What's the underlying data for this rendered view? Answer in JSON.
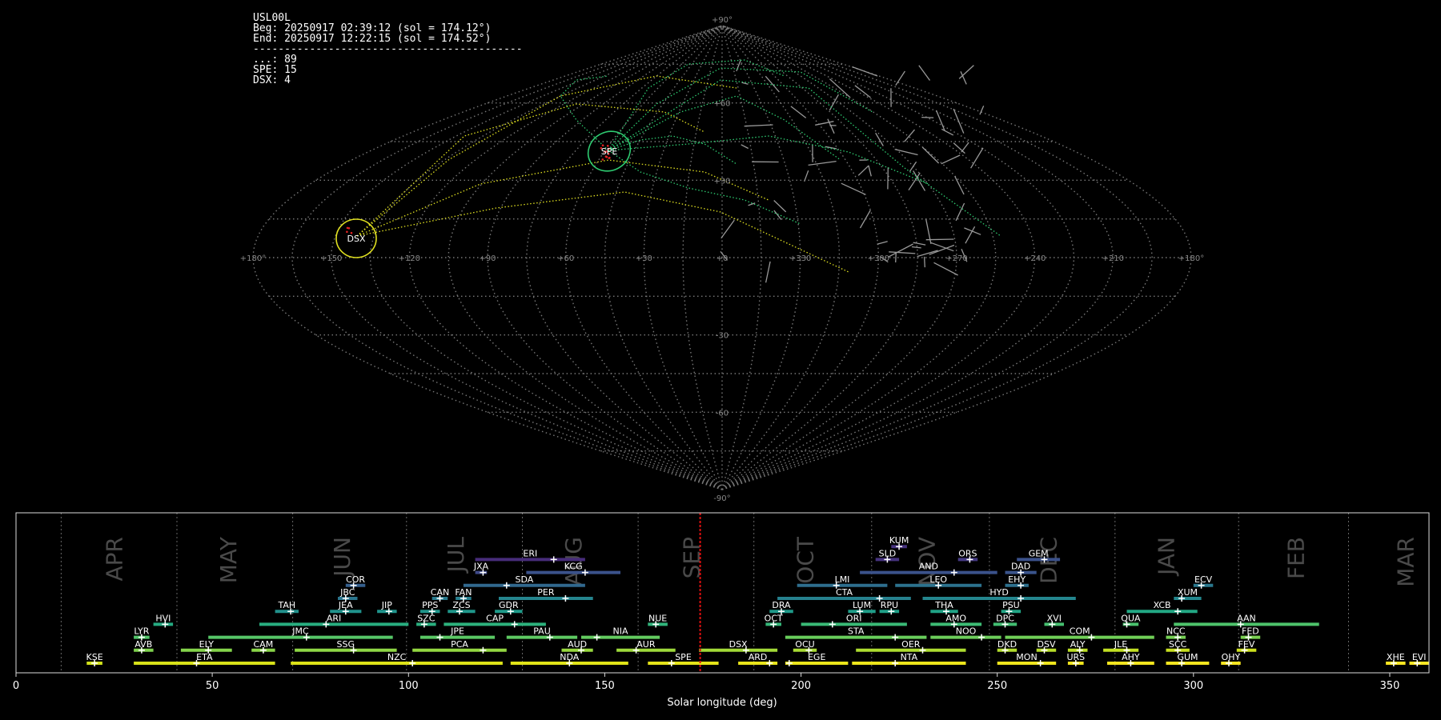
{
  "station": "USL00L",
  "begin_text": "Beg: 20250917 02:39:12 (sol = 174.12°)",
  "end_text": "End: 20250917 12:22:15 (sol = 174.52°)",
  "separator_text": "-------------------------------------------",
  "counts": [
    {
      "code": "...",
      "count": 89,
      "text": "...: 89"
    },
    {
      "code": "SPE",
      "count": 15,
      "text": "SPE: 15"
    },
    {
      "code": "DSX",
      "count": 4,
      "text": "DSX: 4"
    }
  ],
  "sky_map": {
    "projection": "sinusoidal",
    "lon_labels": [
      "+180°",
      "+150",
      "+120",
      "+90",
      "+60",
      "+30",
      "+0",
      "+330",
      "+300",
      "+270",
      "+240",
      "+210",
      "+180°"
    ],
    "lat_labels": [
      "+90°",
      "+60",
      "+30",
      "-30",
      "-60",
      "-90°"
    ],
    "radiants": [
      {
        "code": "SPE",
        "color": "#2ecc71"
      },
      {
        "code": "DSX",
        "color": "#e0e020"
      }
    ]
  },
  "chart_data": {
    "type": "timeline",
    "xlabel": "Solar longitude (deg)",
    "xlim": [
      0,
      360
    ],
    "x_ticks": [
      0,
      50,
      100,
      150,
      200,
      250,
      300,
      350
    ],
    "current_sol": 174.3,
    "months": [
      {
        "name": "APR",
        "start": 11.5,
        "label_at": 25
      },
      {
        "name": "MAY",
        "start": 41,
        "label_at": 54
      },
      {
        "name": "JUN",
        "start": 70.5,
        "label_at": 83
      },
      {
        "name": "JUL",
        "start": 99.5,
        "label_at": 112
      },
      {
        "name": "AUG",
        "start": 129,
        "label_at": 142
      },
      {
        "name": "SEP",
        "start": 158.5,
        "label_at": 172
      },
      {
        "name": "OCT",
        "start": 188,
        "label_at": 201
      },
      {
        "name": "NOV",
        "start": 218,
        "label_at": 232
      },
      {
        "name": "DEC",
        "start": 248,
        "label_at": 263
      },
      {
        "name": "JAN",
        "start": 280,
        "label_at": 293
      },
      {
        "name": "FEB",
        "start": 311.5,
        "label_at": 326
      },
      {
        "name": "MAR",
        "start": 339.5,
        "label_at": 354
      }
    ],
    "showers": [
      {
        "code": "KUM",
        "start": 223,
        "end": 227,
        "peak": 225,
        "row": 10,
        "color": "#46327e"
      },
      {
        "code": "ERI",
        "start": 117,
        "end": 145,
        "peak": 137,
        "row": 9,
        "color": "#472c7a"
      },
      {
        "code": "SLD",
        "start": 219,
        "end": 225,
        "peak": 222,
        "row": 9,
        "color": "#46337f"
      },
      {
        "code": "ORS",
        "start": 240,
        "end": 245,
        "peak": 243,
        "row": 9,
        "color": "#443983"
      },
      {
        "code": "GEM",
        "start": 255,
        "end": 266,
        "peak": 262,
        "row": 9,
        "color": "#3b518b"
      },
      {
        "code": "JXA",
        "start": 117,
        "end": 120,
        "peak": 119,
        "row": 8,
        "color": "#3e4989"
      },
      {
        "code": "KCG",
        "start": 130,
        "end": 154,
        "peak": 145,
        "row": 8,
        "color": "#3b528b"
      },
      {
        "code": "AND",
        "start": 215,
        "end": 250,
        "peak": 239,
        "row": 8,
        "color": "#3b528b"
      },
      {
        "code": "DAD",
        "start": 252,
        "end": 260,
        "peak": 256,
        "row": 8,
        "color": "#3a548c"
      },
      {
        "code": "COR",
        "start": 84,
        "end": 89,
        "peak": 86,
        "row": 7,
        "color": "#355f8d"
      },
      {
        "code": "SDA",
        "start": 114,
        "end": 145,
        "peak": 125,
        "row": 7,
        "color": "#31688e"
      },
      {
        "code": "LMI",
        "start": 199,
        "end": 222,
        "peak": 209,
        "row": 7,
        "color": "#2e6e8e"
      },
      {
        "code": "LEO",
        "start": 224,
        "end": 246,
        "peak": 235,
        "row": 7,
        "color": "#2c728e"
      },
      {
        "code": "EHY",
        "start": 252,
        "end": 258,
        "peak": 256,
        "row": 7,
        "color": "#2d708e"
      },
      {
        "code": "ECV",
        "start": 300,
        "end": 305,
        "peak": 302,
        "row": 7,
        "color": "#2a788e"
      },
      {
        "code": "JBC",
        "start": 82,
        "end": 87,
        "peak": 84,
        "row": 6,
        "color": "#2a768e"
      },
      {
        "code": "CAN",
        "start": 106,
        "end": 110,
        "peak": 108,
        "row": 6,
        "color": "#297b8e"
      },
      {
        "code": "FAN",
        "start": 112,
        "end": 116,
        "peak": 114,
        "row": 6,
        "color": "#277f8e"
      },
      {
        "code": "PER",
        "start": 123,
        "end": 147,
        "peak": 140,
        "row": 6,
        "color": "#25858e"
      },
      {
        "code": "CTA",
        "start": 194,
        "end": 228,
        "peak": 220,
        "row": 6,
        "color": "#26818e"
      },
      {
        "code": "HYD",
        "start": 231,
        "end": 270,
        "peak": 256,
        "row": 6,
        "color": "#24868e"
      },
      {
        "code": "XUM",
        "start": 295,
        "end": 302,
        "peak": 297,
        "row": 6,
        "color": "#23888e"
      },
      {
        "code": "TAH",
        "start": 66,
        "end": 72,
        "peak": 70,
        "row": 5,
        "color": "#21918c"
      },
      {
        "code": "JEA",
        "start": 80,
        "end": 88,
        "peak": 84,
        "row": 5,
        "color": "#20928c"
      },
      {
        "code": "JIP",
        "start": 92,
        "end": 97,
        "peak": 95,
        "row": 5,
        "color": "#1f948c"
      },
      {
        "code": "PPS",
        "start": 103,
        "end": 108,
        "peak": 106,
        "row": 5,
        "color": "#1f958b"
      },
      {
        "code": "ZCS",
        "start": 110,
        "end": 117,
        "peak": 113,
        "row": 5,
        "color": "#1f978b"
      },
      {
        "code": "GDR",
        "start": 122,
        "end": 129,
        "peak": 126,
        "row": 5,
        "color": "#1e9b8a"
      },
      {
        "code": "DRA",
        "start": 192,
        "end": 198,
        "peak": 195,
        "row": 5,
        "color": "#1f9a8a"
      },
      {
        "code": "LUM",
        "start": 212,
        "end": 219,
        "peak": 215,
        "row": 5,
        "color": "#1f9e89"
      },
      {
        "code": "RPU",
        "start": 220,
        "end": 225,
        "peak": 223,
        "row": 5,
        "color": "#1fa088"
      },
      {
        "code": "THA",
        "start": 233,
        "end": 240,
        "peak": 237,
        "row": 5,
        "color": "#20a386"
      },
      {
        "code": "PSU",
        "start": 251,
        "end": 256,
        "peak": 253,
        "row": 5,
        "color": "#21a585"
      },
      {
        "code": "XCB",
        "start": 283,
        "end": 301,
        "peak": 296,
        "row": 5,
        "color": "#22a884"
      },
      {
        "code": "HVI",
        "start": 35,
        "end": 40,
        "peak": 38,
        "row": 4,
        "color": "#25ab82"
      },
      {
        "code": "ARI",
        "start": 62,
        "end": 100,
        "peak": 79,
        "row": 4,
        "color": "#28ae80"
      },
      {
        "code": "SZC",
        "start": 102,
        "end": 107,
        "peak": 104,
        "row": 4,
        "color": "#2ab07f"
      },
      {
        "code": "CAP",
        "start": 109,
        "end": 135,
        "peak": 127,
        "row": 4,
        "color": "#2db27d"
      },
      {
        "code": "NUE",
        "start": 161,
        "end": 166,
        "peak": 163,
        "row": 4,
        "color": "#31b57b"
      },
      {
        "code": "OCT",
        "start": 191,
        "end": 195,
        "peak": 193,
        "row": 4,
        "color": "#35b779"
      },
      {
        "code": "ORI",
        "start": 200,
        "end": 227,
        "peak": 208,
        "row": 4,
        "color": "#3aba76"
      },
      {
        "code": "AMO",
        "start": 233,
        "end": 246,
        "peak": 239,
        "row": 4,
        "color": "#3dbc74"
      },
      {
        "code": "DPC",
        "start": 249,
        "end": 255,
        "peak": 252,
        "row": 4,
        "color": "#42be71"
      },
      {
        "code": "XVI",
        "start": 262,
        "end": 267,
        "peak": 264,
        "row": 4,
        "color": "#46c06f"
      },
      {
        "code": "QUA",
        "start": 282,
        "end": 286,
        "peak": 283,
        "row": 4,
        "color": "#4ac16d"
      },
      {
        "code": "AAN",
        "start": 295,
        "end": 332,
        "peak": 312,
        "row": 4,
        "color": "#4ec36b"
      },
      {
        "code": "LYR",
        "start": 30,
        "end": 34,
        "peak": 32,
        "row": 3,
        "color": "#52c569"
      },
      {
        "code": "JMC",
        "start": 49,
        "end": 96,
        "peak": 74,
        "row": 3,
        "color": "#56c667"
      },
      {
        "code": "JPE",
        "start": 103,
        "end": 122,
        "peak": 108,
        "row": 3,
        "color": "#5ac864"
      },
      {
        "code": "PAU",
        "start": 125,
        "end": 143,
        "peak": 136,
        "row": 3,
        "color": "#5ec962"
      },
      {
        "code": "NIA",
        "start": 144,
        "end": 164,
        "peak": 148,
        "row": 3,
        "color": "#63cb5f"
      },
      {
        "code": "STA",
        "start": 196,
        "end": 232,
        "peak": 224,
        "row": 3,
        "color": "#68cd5b"
      },
      {
        "code": "NOO",
        "start": 233,
        "end": 251,
        "peak": 246,
        "row": 3,
        "color": "#6ccd5a"
      },
      {
        "code": "COM",
        "start": 252,
        "end": 290,
        "peak": 274,
        "row": 3,
        "color": "#70cf57"
      },
      {
        "code": "NCC",
        "start": 293,
        "end": 298,
        "peak": 296,
        "row": 3,
        "color": "#75d054"
      },
      {
        "code": "FED",
        "start": 312,
        "end": 317,
        "peak": 314,
        "row": 3,
        "color": "#7ad151"
      },
      {
        "code": "AVB",
        "start": 30,
        "end": 35,
        "peak": 32,
        "row": 2,
        "color": "#7fd34e"
      },
      {
        "code": "ELY",
        "start": 42,
        "end": 55,
        "peak": 49,
        "row": 2,
        "color": "#84d44b"
      },
      {
        "code": "CAM",
        "start": 60,
        "end": 66,
        "peak": 63,
        "row": 2,
        "color": "#89d548"
      },
      {
        "code": "SSG",
        "start": 71,
        "end": 97,
        "peak": 86,
        "row": 2,
        "color": "#8ed645"
      },
      {
        "code": "PCA",
        "start": 101,
        "end": 125,
        "peak": 119,
        "row": 2,
        "color": "#93d741"
      },
      {
        "code": "AUD",
        "start": 139,
        "end": 147,
        "peak": 144,
        "row": 2,
        "color": "#98d83e"
      },
      {
        "code": "AUR",
        "start": 153,
        "end": 168,
        "peak": 158,
        "row": 2,
        "color": "#9dd93b"
      },
      {
        "code": "DSX",
        "start": 174,
        "end": 194,
        "peak": 186,
        "row": 2,
        "color": "#a2da37"
      },
      {
        "code": "OCU",
        "start": 198,
        "end": 204,
        "peak": 202,
        "row": 2,
        "color": "#a8db34"
      },
      {
        "code": "OER",
        "start": 214,
        "end": 242,
        "peak": 231,
        "row": 2,
        "color": "#addc30"
      },
      {
        "code": "DKD",
        "start": 250,
        "end": 255,
        "peak": 252,
        "row": 2,
        "color": "#b2dd2d"
      },
      {
        "code": "DSV",
        "start": 260,
        "end": 265,
        "peak": 262,
        "row": 2,
        "color": "#b8de29"
      },
      {
        "code": "ALY",
        "start": 268,
        "end": 273,
        "peak": 271,
        "row": 2,
        "color": "#bddf26"
      },
      {
        "code": "JLE",
        "start": 277,
        "end": 286,
        "peak": 283,
        "row": 2,
        "color": "#c2df23"
      },
      {
        "code": "SCC",
        "start": 293,
        "end": 299,
        "peak": 296,
        "row": 2,
        "color": "#c8e020"
      },
      {
        "code": "FEV",
        "start": 311,
        "end": 316,
        "peak": 313,
        "row": 2,
        "color": "#cde11d"
      },
      {
        "code": "KSE",
        "start": 18,
        "end": 22,
        "peak": 20,
        "row": 1,
        "color": "#d2e21b"
      },
      {
        "code": "ETA",
        "start": 30,
        "end": 66,
        "peak": 46,
        "row": 1,
        "color": "#d8e219"
      },
      {
        "code": "NZC",
        "start": 70,
        "end": 124,
        "peak": 101,
        "row": 1,
        "color": "#dde318"
      },
      {
        "code": "NDA",
        "start": 126,
        "end": 156,
        "peak": 141,
        "row": 1,
        "color": "#e1e418"
      },
      {
        "code": "SPE",
        "start": 161,
        "end": 179,
        "peak": 167,
        "row": 1,
        "color": "#e5e419"
      },
      {
        "code": "ARD",
        "start": 184,
        "end": 194,
        "peak": 192,
        "row": 1,
        "color": "#e8e41a"
      },
      {
        "code": "EGE",
        "start": 196,
        "end": 212,
        "peak": 197,
        "row": 1,
        "color": "#ebe51a"
      },
      {
        "code": "NTA",
        "start": 213,
        "end": 242,
        "peak": 224,
        "row": 1,
        "color": "#ede51b"
      },
      {
        "code": "MON",
        "start": 250,
        "end": 265,
        "peak": 261,
        "row": 1,
        "color": "#efe51c"
      },
      {
        "code": "URS",
        "start": 268,
        "end": 272,
        "peak": 270,
        "row": 1,
        "color": "#f1e51d"
      },
      {
        "code": "AHY",
        "start": 278,
        "end": 290,
        "peak": 284,
        "row": 1,
        "color": "#f3e51e"
      },
      {
        "code": "GUM",
        "start": 293,
        "end": 304,
        "peak": 297,
        "row": 1,
        "color": "#f5e61f"
      },
      {
        "code": "OHY",
        "start": 307,
        "end": 312,
        "peak": 309,
        "row": 1,
        "color": "#f7e620"
      },
      {
        "code": "XHE",
        "start": 349,
        "end": 354,
        "peak": 351,
        "row": 1,
        "color": "#f9e621"
      },
      {
        "code": "EVI",
        "start": 355,
        "end": 360,
        "peak": 357,
        "row": 1,
        "color": "#fbe723"
      }
    ]
  }
}
